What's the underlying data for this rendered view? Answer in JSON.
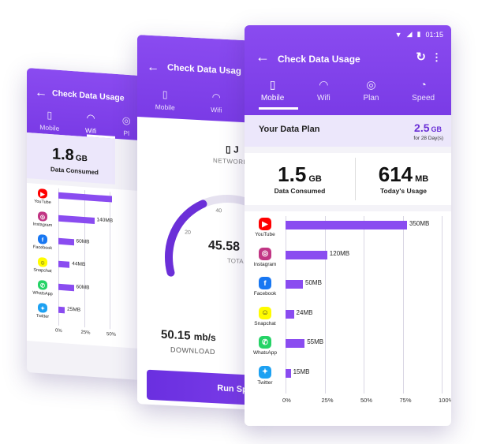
{
  "colors": {
    "accent": "#7b3fe4",
    "bar": "#8a4cf0",
    "plan_value": "#6a2fd6"
  },
  "front": {
    "status": {
      "time": "01:15"
    },
    "title": "Check Data Usage",
    "tabs": [
      {
        "label": "Mobile",
        "icon": "phone-icon"
      },
      {
        "label": "Wifi",
        "icon": "wifi-icon"
      },
      {
        "label": "Plan",
        "icon": "plan-icon"
      },
      {
        "label": "Speed",
        "icon": "speed-icon"
      }
    ],
    "plan": {
      "label": "Your Data Plan",
      "value": "2.5",
      "unit": "GB",
      "period": "for 28 Day(s)"
    },
    "consumed": {
      "value": "1.5",
      "unit": "GB",
      "label": "Data Consumed"
    },
    "today": {
      "value": "614",
      "unit": "MB",
      "label": "Today's Usage"
    },
    "apps": [
      {
        "name": "YouTube",
        "value": 350,
        "label": "350MB",
        "color": "#ff0000",
        "icon": "youtube-icon"
      },
      {
        "name": "Instagram",
        "value": 120,
        "label": "120MB",
        "color": "#c13584",
        "icon": "instagram-icon"
      },
      {
        "name": "Facebook",
        "value": 50,
        "label": "50MB",
        "color": "#1877f2",
        "icon": "facebook-icon"
      },
      {
        "name": "Snapchat",
        "value": 24,
        "label": "24MB",
        "color": "#fffc00",
        "icon": "snapchat-icon"
      },
      {
        "name": "WhatsApp",
        "value": 55,
        "label": "55MB",
        "color": "#25d366",
        "icon": "whatsapp-icon"
      },
      {
        "name": "Twitter",
        "value": 15,
        "label": "15MB",
        "color": "#1da1f2",
        "icon": "twitter-icon"
      }
    ],
    "axis_ticks": [
      "0%",
      "25%",
      "50%",
      "75%",
      "100%"
    ],
    "axis_max": 450
  },
  "mid": {
    "title": "Check Data Usag",
    "tabs": [
      {
        "label": "Mobile",
        "icon": "phone-icon"
      },
      {
        "label": "Wifi",
        "icon": "wifi-icon"
      }
    ],
    "network_prefix": "J",
    "network_label": "NETWORK",
    "gauge_ticks": [
      "20",
      "40"
    ],
    "total_value": "45.58",
    "total_label": "TOTA",
    "download_value": "50.15",
    "download_unit": "mb/s",
    "download_label": "DOWNLOAD",
    "run_label": "Run Spee",
    "gauge_fraction": 0.62
  },
  "back": {
    "title": "Check Data Usage",
    "tabs": [
      {
        "label": "Mobile",
        "icon": "phone-icon"
      },
      {
        "label": "Wifi",
        "icon": "wifi-icon"
      },
      {
        "label": "Pl",
        "icon": "plan-icon"
      }
    ],
    "consumed": {
      "value": "1.8",
      "unit": "GB",
      "label": "Data Consumed"
    },
    "apps": [
      {
        "name": "YouTube",
        "value": 210,
        "label": "",
        "color": "#ff0000",
        "icon": "youtube-icon"
      },
      {
        "name": "Instagram",
        "value": 140,
        "label": "140MB",
        "color": "#c13584",
        "icon": "instagram-icon"
      },
      {
        "name": "Facebook",
        "value": 60,
        "label": "60MB",
        "color": "#1877f2",
        "icon": "facebook-icon"
      },
      {
        "name": "Snapchat",
        "value": 44,
        "label": "44MB",
        "color": "#fffc00",
        "icon": "snapchat-icon"
      },
      {
        "name": "WhatsApp",
        "value": 60,
        "label": "60MB",
        "color": "#25d366",
        "icon": "whatsapp-icon"
      },
      {
        "name": "Twitter",
        "value": 25,
        "label": "25MB",
        "color": "#1da1f2",
        "icon": "twitter-icon"
      }
    ],
    "axis_ticks": [
      "0%",
      "25%",
      "50%"
    ],
    "axis_max": 400
  }
}
